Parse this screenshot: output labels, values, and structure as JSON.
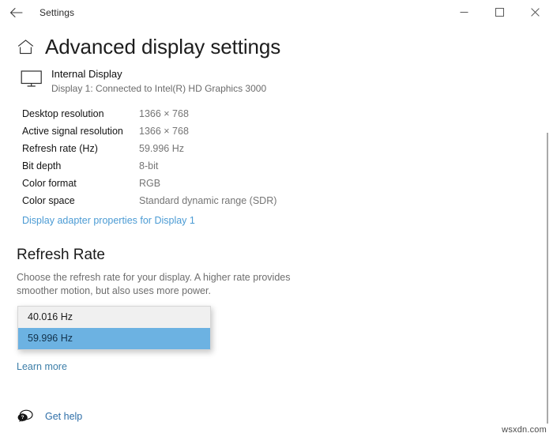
{
  "window": {
    "app_title": "Settings",
    "back_icon": "back-arrow-icon",
    "minimize_label": "—",
    "maximize_label": "□",
    "close_label": "✕"
  },
  "page": {
    "home_icon": "home-icon",
    "title": "Advanced display settings"
  },
  "display": {
    "monitor_icon": "monitor-icon",
    "name": "Internal Display",
    "subtitle": "Display 1: Connected to Intel(R) HD Graphics 3000"
  },
  "specs": [
    {
      "label": "Desktop resolution",
      "value": "1366 × 768"
    },
    {
      "label": "Active signal resolution",
      "value": "1366 × 768"
    },
    {
      "label": "Refresh rate (Hz)",
      "value": "59.996 Hz"
    },
    {
      "label": "Bit depth",
      "value": "8-bit"
    },
    {
      "label": "Color format",
      "value": "RGB"
    },
    {
      "label": "Color space",
      "value": "Standard dynamic range (SDR)"
    }
  ],
  "adapter_link": "Display adapter properties for Display 1",
  "refresh_rate": {
    "heading": "Refresh Rate",
    "description": "Choose the refresh rate for your display. A higher rate provides smoother motion, but also uses more power.",
    "options": [
      {
        "label": "40.016 Hz",
        "selected": false
      },
      {
        "label": "59.996 Hz",
        "selected": true
      }
    ],
    "selected_value": "59.996 Hz",
    "learn_more": "Learn more"
  },
  "footer": {
    "help_icon": "help-speech-bubble-icon",
    "get_help": "Get help"
  },
  "watermark": "wsxdn.com",
  "colors": {
    "accent_link": "#4b9bd4",
    "selection_blue": "#6cb2e2",
    "muted_text": "#757575"
  }
}
